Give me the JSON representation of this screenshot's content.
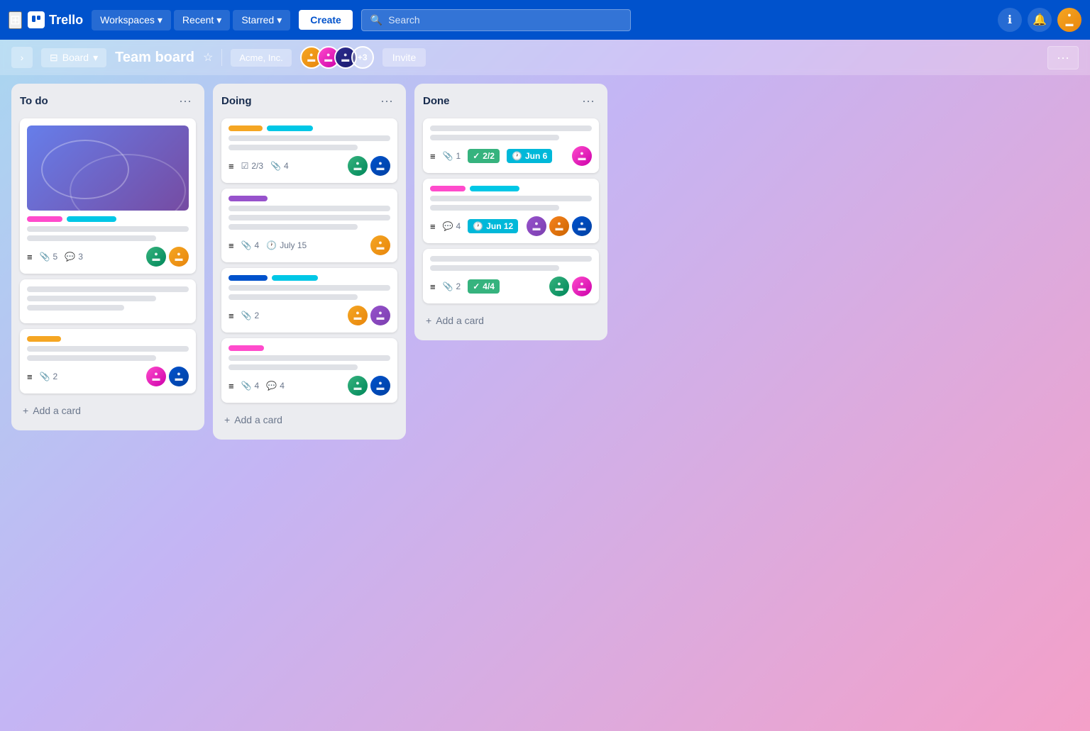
{
  "app": {
    "name": "Trello",
    "logo_letter": "T"
  },
  "navbar": {
    "workspaces_label": "Workspaces",
    "recent_label": "Recent",
    "starred_label": "Starred",
    "create_label": "Create",
    "search_placeholder": "Search"
  },
  "board_header": {
    "view_label": "Board",
    "title": "Team board",
    "workspace_name": "Acme, Inc.",
    "member_count": "+3",
    "invite_label": "Invite",
    "more_label": "···"
  },
  "columns": [
    {
      "id": "todo",
      "title": "To do",
      "cards": [
        {
          "id": "todo-1",
          "has_cover": true,
          "tags": [
            "pink",
            "cyan"
          ],
          "lines": [
            "full",
            "medium"
          ],
          "meta": {
            "clip": 5,
            "comment": 3
          },
          "avatars": [
            "av3",
            "av1"
          ]
        },
        {
          "id": "todo-2",
          "has_cover": false,
          "tags": [],
          "lines": [
            "full",
            "medium",
            "short"
          ],
          "meta": {},
          "avatars": []
        },
        {
          "id": "todo-3",
          "has_cover": false,
          "tags": [
            "yellow"
          ],
          "lines": [
            "full",
            "medium"
          ],
          "meta": {
            "clip": 2
          },
          "avatars": [
            "av2",
            "av4"
          ]
        }
      ],
      "add_label": "Add a card"
    },
    {
      "id": "doing",
      "title": "Doing",
      "cards": [
        {
          "id": "doing-1",
          "has_cover": false,
          "tags": [
            "yellow",
            "blue-light"
          ],
          "lines": [
            "full",
            "medium"
          ],
          "meta": {
            "check": "2/3",
            "clip": 4
          },
          "avatars": [
            "av3",
            "av4"
          ]
        },
        {
          "id": "doing-2",
          "has_cover": false,
          "tags": [
            "purple"
          ],
          "lines": [
            "full",
            "full",
            "medium"
          ],
          "meta": {
            "clip": 4,
            "due": "July 15"
          },
          "avatars": [
            "av1"
          ]
        },
        {
          "id": "doing-3",
          "has_cover": false,
          "tags": [
            "blue-dark",
            "cyan"
          ],
          "lines": [
            "full",
            "medium"
          ],
          "meta": {
            "clip": 2
          },
          "avatars": [
            "av1",
            "av5"
          ]
        },
        {
          "id": "doing-4",
          "has_cover": false,
          "tags": [
            "pink"
          ],
          "lines": [
            "full",
            "medium"
          ],
          "meta": {
            "clip": 4,
            "comment": 4
          },
          "avatars": [
            "av3",
            "av4"
          ]
        }
      ],
      "add_label": "Add a card"
    },
    {
      "id": "done",
      "title": "Done",
      "cards": [
        {
          "id": "done-1",
          "has_cover": false,
          "tags": [],
          "lines": [
            "full",
            "medium"
          ],
          "meta": {
            "clip": 1,
            "check": "2/2",
            "due": "Jun 6"
          },
          "avatars": [
            "av2"
          ]
        },
        {
          "id": "done-2",
          "has_cover": false,
          "tags": [
            "pink",
            "cyan"
          ],
          "lines": [
            "full",
            "medium"
          ],
          "meta": {
            "comment": 4,
            "due": "Jun 12"
          },
          "avatars": [
            "av5",
            "av7",
            "av4"
          ]
        },
        {
          "id": "done-3",
          "has_cover": false,
          "tags": [],
          "lines": [
            "full",
            "medium"
          ],
          "meta": {
            "clip": 2,
            "check": "4/4"
          },
          "avatars": [
            "av3",
            "av2"
          ]
        }
      ],
      "add_label": "Add a card"
    }
  ]
}
